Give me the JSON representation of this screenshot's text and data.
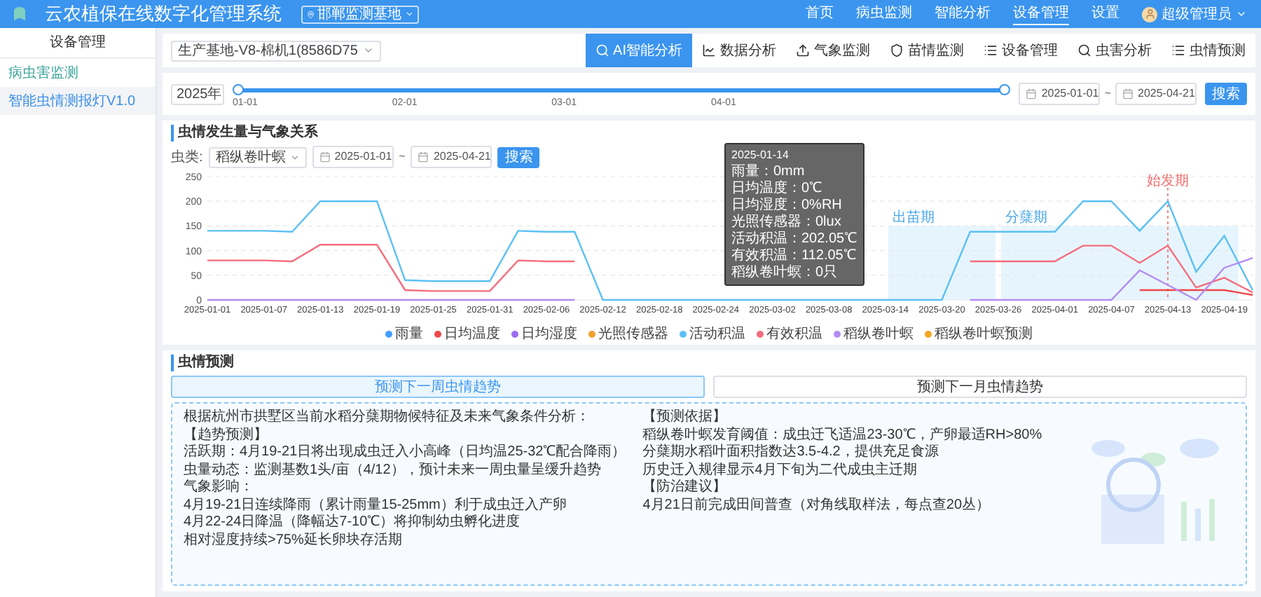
{
  "header": {
    "title": "云农植保在线数字化管理系统",
    "site": "邯郸监测基地",
    "nav": [
      {
        "label": "首页",
        "selected": false
      },
      {
        "label": "病虫监测",
        "selected": false
      },
      {
        "label": "智能分析",
        "selected": false
      },
      {
        "label": "设备管理",
        "selected": true
      },
      {
        "label": "设置",
        "selected": false
      }
    ],
    "user": "超级管理员"
  },
  "sidebar": {
    "title": "设备管理",
    "items": [
      {
        "label": "病虫害监测",
        "selected": false
      },
      {
        "label": "智能虫情测报灯V1.0",
        "selected": true
      }
    ]
  },
  "toolbar": {
    "device": "生产基地-V8-棉机1(8586D75",
    "tabs": [
      {
        "label": "AI智能分析",
        "selected": true
      },
      {
        "label": "数据分析",
        "selected": false
      },
      {
        "label": "气象监测",
        "selected": false
      },
      {
        "label": "苗情监测",
        "selected": false
      },
      {
        "label": "设备管理",
        "selected": false
      },
      {
        "label": "虫害分析",
        "selected": false
      },
      {
        "label": "虫情预测",
        "selected": false
      }
    ]
  },
  "timeline": {
    "year": "2025年",
    "level": 1,
    "ticks": [
      "01-01",
      "02-01",
      "03-01",
      "04-01"
    ],
    "start": "2025-01-01",
    "separator": "~",
    "end": "2025-04-21",
    "button": "搜索"
  },
  "chart_section": {
    "title": "虫情发生量与气象关系",
    "filter_label": "虫类:",
    "pest": "稻纵卷叶螟",
    "start": "2025-01-01",
    "separator": "~",
    "end": "2025-04-21",
    "button": "搜索",
    "tooltip": {
      "title": "2025-01-14",
      "lines": [
        "雨量：0mm",
        "日均温度：0℃",
        "日均湿度：0%RH",
        "光照传感器：0lux",
        "活动积温：202.05℃",
        "有效积温：112.05℃",
        "稻纵卷叶螟：0只"
      ]
    },
    "chart_data": {
      "type": "line",
      "categories": [
        "2025-01-01",
        null,
        "2025-01-07",
        null,
        "2025-01-13",
        null,
        "2025-01-19",
        null,
        "2025-01-25",
        null,
        "2025-01-31",
        null,
        "2025-02-06",
        null,
        "2025-02-12",
        null,
        "2025-02-18",
        null,
        "2025-02-24",
        null,
        "2025-03-02",
        null,
        "2025-03-08",
        null,
        "2025-03-14",
        null,
        "2025-03-20",
        null,
        "2025-03-26",
        null,
        "2025-04-01",
        null,
        "2025-04-07",
        null,
        "2025-04-13",
        null,
        "2025-04-19",
        null
      ],
      "ylim": [
        0,
        250
      ],
      "yticks": [
        0,
        50,
        100,
        150,
        200,
        250
      ],
      "series": [
        {
          "name": "雨量",
          "color": "#409eff",
          "values": [
            null,
            null,
            null,
            null,
            null,
            null,
            null,
            null,
            null,
            null,
            null,
            null,
            null,
            null,
            null,
            null,
            null,
            null,
            null,
            null,
            null,
            null,
            null,
            null,
            null,
            null,
            null,
            null,
            null,
            null,
            null,
            null,
            null,
            null,
            null,
            null,
            null,
            null
          ]
        },
        {
          "name": "日均温度",
          "color": "#f04848",
          "values": [
            null,
            null,
            null,
            null,
            null,
            null,
            null,
            null,
            null,
            null,
            null,
            null,
            null,
            null,
            null,
            null,
            null,
            null,
            null,
            null,
            null,
            null,
            null,
            null,
            null,
            null,
            null,
            null,
            null,
            null,
            null,
            null,
            null,
            20,
            20,
            20,
            20,
            10
          ]
        },
        {
          "name": "日均湿度",
          "color": "#9b6cf0",
          "values": [
            null,
            null,
            null,
            null,
            null,
            null,
            null,
            null,
            null,
            null,
            null,
            null,
            null,
            null,
            null,
            null,
            null,
            null,
            null,
            null,
            null,
            null,
            null,
            null,
            null,
            null,
            null,
            null,
            null,
            null,
            null,
            null,
            null,
            null,
            null,
            null,
            null,
            null
          ]
        },
        {
          "name": "光照传感器",
          "color": "#f0a030",
          "values": [
            null,
            null,
            null,
            null,
            null,
            null,
            null,
            null,
            null,
            null,
            null,
            null,
            null,
            null,
            null,
            null,
            null,
            null,
            null,
            null,
            null,
            null,
            null,
            null,
            null,
            null,
            null,
            null,
            null,
            null,
            null,
            null,
            null,
            null,
            null,
            null,
            null,
            null
          ]
        },
        {
          "name": "活动积温",
          "color": "#5bc0f5",
          "values": [
            140,
            140,
            140,
            138,
            200,
            200,
            200,
            40,
            38,
            38,
            38,
            140,
            138,
            138,
            0,
            0,
            0,
            0,
            0,
            0,
            0,
            0,
            0,
            0,
            0,
            0,
            0,
            138,
            138,
            138,
            138,
            200,
            200,
            140,
            200,
            57,
            130,
            20
          ]
        },
        {
          "name": "有效积温",
          "color": "#f56c7c",
          "values": [
            80,
            80,
            80,
            78,
            112,
            112,
            112,
            20,
            18,
            18,
            18,
            80,
            78,
            78,
            null,
            null,
            null,
            null,
            null,
            null,
            null,
            null,
            null,
            null,
            null,
            null,
            null,
            78,
            78,
            78,
            78,
            110,
            110,
            75,
            110,
            25,
            45,
            15
          ]
        },
        {
          "name": "稻纵卷叶螟",
          "color": "#b48cf2",
          "values": [
            0,
            0,
            0,
            0,
            0,
            0,
            0,
            0,
            0,
            0,
            0,
            0,
            0,
            0,
            null,
            null,
            null,
            null,
            null,
            null,
            null,
            null,
            null,
            null,
            null,
            null,
            null,
            0,
            0,
            0,
            0,
            0,
            0,
            60,
            30,
            0,
            65,
            85
          ]
        },
        {
          "name": "稻纵卷叶螟预测",
          "color": "#f5a623",
          "values": [
            null,
            null,
            null,
            null,
            null,
            null,
            null,
            null,
            null,
            null,
            null,
            null,
            null,
            null,
            null,
            null,
            null,
            null,
            null,
            null,
            null,
            null,
            null,
            null,
            null,
            null,
            null,
            null,
            null,
            null,
            null,
            null,
            null,
            null,
            null,
            null,
            null,
            null
          ]
        }
      ],
      "grid": true,
      "legend": "bottom"
    },
    "stages": [
      {
        "kind": "band",
        "label": "出苗期"
      },
      {
        "kind": "band",
        "label": "分蘖期"
      },
      {
        "kind": "marker",
        "label": "始发期"
      }
    ]
  },
  "forecast": {
    "title": "虫情预测",
    "buttons": [
      {
        "label": "预测下一周虫情趋势",
        "selected": true
      },
      {
        "label": "预测下一月虫情趋势",
        "selected": false
      }
    ],
    "columns": [
      [
        "根据杭州市拱墅区当前水稻分蘖期物候特征及未来气象条件分析：",
        "【趋势预测】",
        "活跃期：4月19-21日将出现成虫迁入小高峰（日均温25-32℃配合降雨）",
        "虫量动态：监测基数1头/亩（4/12），预计未来一周虫量呈缓升趋势",
        "气象影响：",
        "4月19-21日连续降雨（累计雨量15-25mm）利于成虫迁入产卵",
        "4月22-24日降温（降幅达7-10℃）将抑制幼虫孵化进度",
        "相对湿度持续>75%延长卵块存活期"
      ],
      [
        "【预测依据】",
        "稻纵卷叶螟发育阈值：成虫迁飞适温23-30℃，产卵最适RH>80%",
        "分蘖期水稻叶面积指数达3.5-4.2，提供充足食源",
        "历史迁入规律显示4月下旬为二代成虫主迁期",
        "【防治建议】",
        "4月21日前完成田间普查（对角线取样法，每点查20丛）"
      ]
    ]
  }
}
